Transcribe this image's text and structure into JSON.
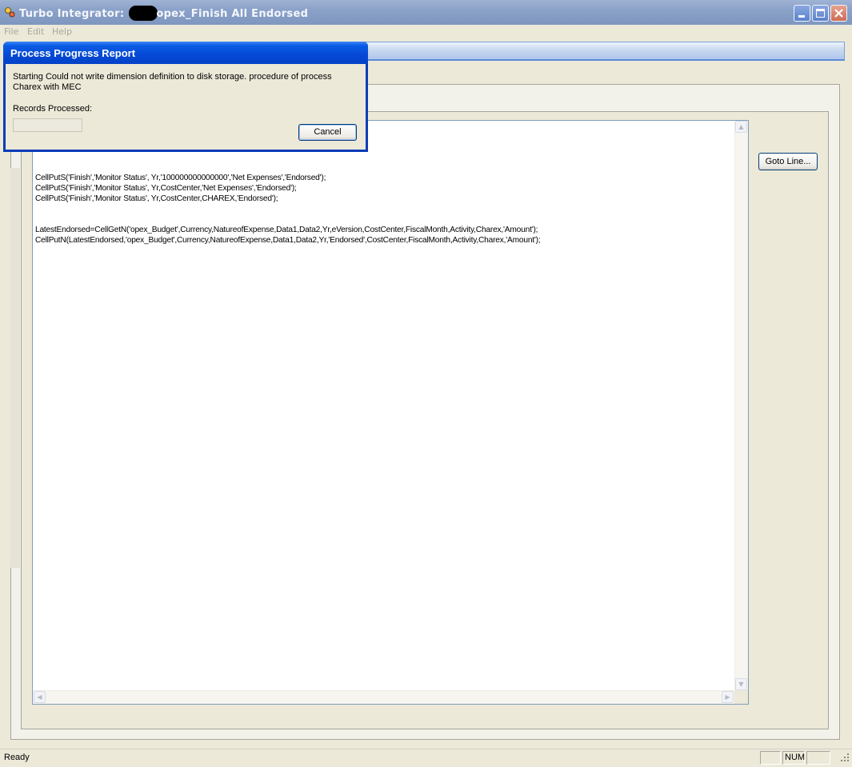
{
  "window": {
    "title_prefix": "Turbo Integrator:",
    "title_suffix": "opex_Finish All Endorsed"
  },
  "menu": {
    "file": "File",
    "edit": "Edit",
    "help": "Help"
  },
  "editor": {
    "lines": [
      "",
      "",
      "",
      "",
      "",
      "CellPutS('Finish','Monitor Status', Yr,'100000000000000','Net Expenses','Endorsed');",
      "CellPutS('Finish','Monitor Status', Yr,CostCenter,'Net Expenses','Endorsed');",
      "CellPutS('Finish','Monitor Status', Yr,CostCenter,CHAREX,'Endorsed');",
      "",
      "",
      "LatestEndorsed=CellGetN('opex_Budget',Currency,NatureofExpense,Data1,Data2,Yr,eVersion,CostCenter,FiscalMonth,Activity,Charex,'Amount');",
      "CellPutN(LatestEndorsed,'opex_Budget',Currency,NatureofExpense,Data1,Data2,Yr,'Endorsed',CostCenter,FiscalMonth,Activity,Charex,'Amount');"
    ]
  },
  "goto_button": "Goto Line...",
  "status": {
    "ready": "Ready",
    "num": "NUM"
  },
  "dialog": {
    "title": "Process Progress Report",
    "message_line1": "Starting Could not write dimension definition to disk storage. procedure of process",
    "message_line2": "Charex with MEC",
    "records_label": "Records Processed:",
    "records_value": "",
    "cancel": "Cancel"
  }
}
